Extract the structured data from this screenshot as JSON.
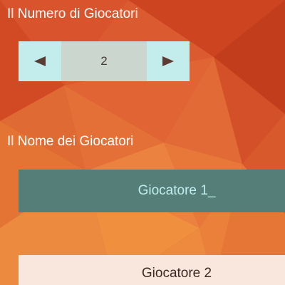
{
  "colors": {
    "background": "#d9502a",
    "stepper_button": "#c3ecec",
    "stepper_value_bg": "#cbd6cf",
    "field_active_bg": "#557e79",
    "field_active_text": "#bfeeee",
    "field_inactive_bg": "#f9e6dc",
    "arrow": "#5a3c34"
  },
  "player_count": {
    "label": "Il Numero di Giocatori",
    "value": "2",
    "decrease_icon": "triangle-left-icon",
    "increase_icon": "triangle-right-icon"
  },
  "player_names": {
    "label": "Il Nome dei Giocatori",
    "fields": [
      {
        "value": "Giocatore 1_",
        "state": "active"
      },
      {
        "value": "Giocatore 2",
        "state": "inactive"
      }
    ]
  }
}
